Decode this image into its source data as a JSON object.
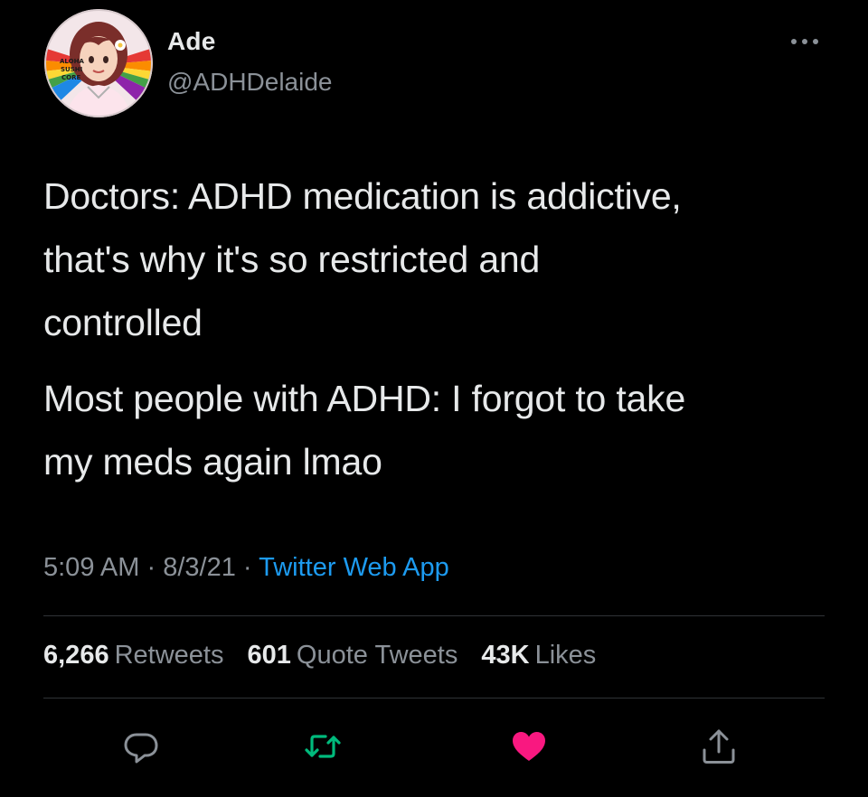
{
  "author": {
    "display_name": "Ade",
    "handle": "@ADHDelaide",
    "avatar_text": [
      "ALOHA",
      "SUSHI",
      "CORE"
    ]
  },
  "menu": {
    "icon": "more-horizontal-icon"
  },
  "tweet": {
    "paragraphs": [
      "Doctors: ADHD medication is addictive,\nthat's why it's so restricted and\ncontrolled",
      "Most people with ADHD: I forgot to take\nmy meds again lmao"
    ]
  },
  "meta": {
    "time": "5:09 AM",
    "separator": "·",
    "date": "8/3/21",
    "source": "Twitter Web App"
  },
  "stats": {
    "retweets": {
      "count": "6,266",
      "label": "Retweets"
    },
    "quotes": {
      "count": "601",
      "label": "Quote Tweets"
    },
    "likes": {
      "count": "43K",
      "label": "Likes"
    }
  },
  "actions": [
    {
      "icon": "reply-icon",
      "color": "#8b9198"
    },
    {
      "icon": "retweet-icon",
      "color": "#00ba7c"
    },
    {
      "icon": "heart-icon",
      "color": "#f91880"
    },
    {
      "icon": "share-icon",
      "color": "#8b9198"
    }
  ],
  "colors": {
    "background": "#000000",
    "text_primary": "#e7e9ea",
    "text_secondary": "#8b9198",
    "link": "#1d9bf0",
    "retweeted": "#00ba7c",
    "liked": "#f91880",
    "divider": "#2f3336"
  }
}
